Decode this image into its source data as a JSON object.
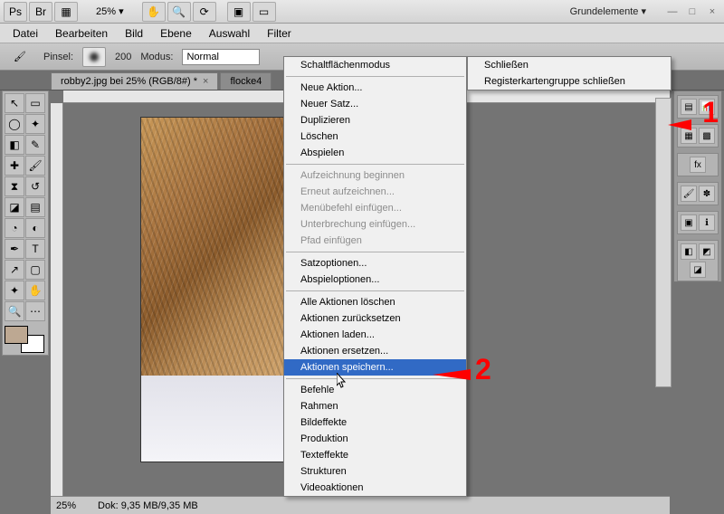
{
  "app": {
    "workspace_label": "Grundelemente ▾",
    "zoom": "25% ▾"
  },
  "menubar": {
    "items": [
      "Datei",
      "Bearbeiten",
      "Bild",
      "Ebene",
      "Auswahl",
      "Filter"
    ]
  },
  "options": {
    "brush_label": "Pinsel:",
    "brush_size": "200",
    "mode_label": "Modus:",
    "mode_value": "Normal"
  },
  "tabs": {
    "active": "robby2.jpg bei 25% (RGB/8#) *",
    "inactive": "flocke4"
  },
  "status": {
    "zoom": "25%",
    "doc": "Dok: 9,35 MB/9,35 MB"
  },
  "context_left": {
    "items": [
      {
        "label": "Schaltflächenmodus",
        "enabled": true
      },
      {
        "sep": true
      },
      {
        "label": "Neue Aktion...",
        "enabled": true
      },
      {
        "label": "Neuer Satz...",
        "enabled": true
      },
      {
        "label": "Duplizieren",
        "enabled": true
      },
      {
        "label": "Löschen",
        "enabled": true
      },
      {
        "label": "Abspielen",
        "enabled": true
      },
      {
        "sep": true
      },
      {
        "label": "Aufzeichnung beginnen",
        "enabled": false
      },
      {
        "label": "Erneut aufzeichnen...",
        "enabled": false
      },
      {
        "label": "Menübefehl einfügen...",
        "enabled": false
      },
      {
        "label": "Unterbrechung einfügen...",
        "enabled": false
      },
      {
        "label": "Pfad einfügen",
        "enabled": false
      },
      {
        "sep": true
      },
      {
        "label": "Satzoptionen...",
        "enabled": true
      },
      {
        "label": "Abspieloptionen...",
        "enabled": true
      },
      {
        "sep": true
      },
      {
        "label": "Alle Aktionen löschen",
        "enabled": true
      },
      {
        "label": "Aktionen zurücksetzen",
        "enabled": true
      },
      {
        "label": "Aktionen laden...",
        "enabled": true
      },
      {
        "label": "Aktionen ersetzen...",
        "enabled": true
      },
      {
        "label": "Aktionen speichern...",
        "enabled": true,
        "hl": true
      },
      {
        "sep": true
      },
      {
        "label": "Befehle",
        "enabled": true
      },
      {
        "label": "Rahmen",
        "enabled": true
      },
      {
        "label": "Bildeffekte",
        "enabled": true
      },
      {
        "label": "Produktion",
        "enabled": true
      },
      {
        "label": "Texteffekte",
        "enabled": true
      },
      {
        "label": "Strukturen",
        "enabled": true
      },
      {
        "label": "Videoaktionen",
        "enabled": true
      }
    ]
  },
  "context_right": {
    "items": [
      {
        "label": "Schließen",
        "enabled": true
      },
      {
        "label": "Registerkartengruppe schließen",
        "enabled": true
      }
    ]
  }
}
